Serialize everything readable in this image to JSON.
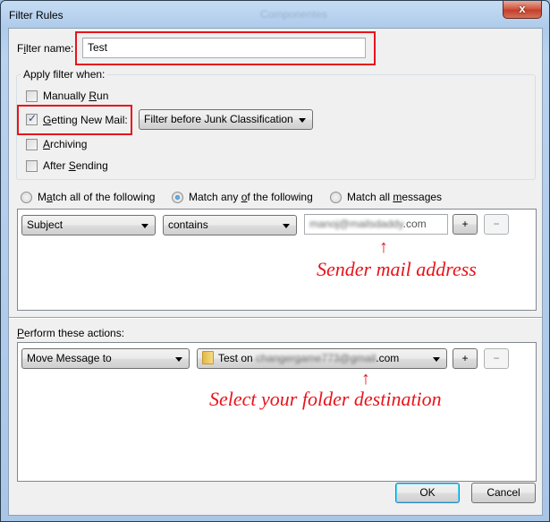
{
  "window": {
    "title": "Filter Rules",
    "background_title": "Componentes",
    "close_glyph": "x"
  },
  "filter_name": {
    "label_pre": "F",
    "label_accel": "i",
    "label_post": "lter name:",
    "value": "Test"
  },
  "apply_when": {
    "legend": "Apply filter when:",
    "options": [
      {
        "pre": "Manually ",
        "accel": "R",
        "post": "un",
        "checked": false
      },
      {
        "pre": "",
        "accel": "G",
        "post": "etting New Mail:",
        "checked": true
      },
      {
        "pre": "",
        "accel": "A",
        "post": "rchiving",
        "checked": false
      },
      {
        "pre": "After ",
        "accel": "S",
        "post": "ending",
        "checked": false
      }
    ],
    "new_mail_timing": "Filter before Junk Classification"
  },
  "match": {
    "options": [
      {
        "pre": "M",
        "accel": "a",
        "post": "tch all of the following",
        "selected": false
      },
      {
        "pre": "Match any ",
        "accel": "o",
        "post": "f the following",
        "selected": true
      },
      {
        "pre": "Match all ",
        "accel": "m",
        "post": "essages",
        "selected": false
      }
    ]
  },
  "rules": [
    {
      "field": "Subject",
      "operator": "contains",
      "value_blurred": "manoj@mailsdaddy",
      "value_suffix": ".com",
      "add_label": "+",
      "remove_label": "−"
    }
  ],
  "actions": {
    "label_accel": "P",
    "label_post": "erform these actions:",
    "items": [
      {
        "action": "Move Message to",
        "folder_pre": "Test on ",
        "folder_blurred": "changergame773@gmail",
        "folder_suffix": ".com",
        "add_label": "+",
        "remove_label": "−"
      }
    ]
  },
  "annotations": {
    "sender": "Sender mail address",
    "folder": "Select your folder destination",
    "arrow": "↑"
  },
  "footer": {
    "ok_label": "OK",
    "cancel_label": "Cancel"
  },
  "colors": {
    "highlight_red": "#e8141b",
    "dialog_bg": "#f0f0f0"
  }
}
